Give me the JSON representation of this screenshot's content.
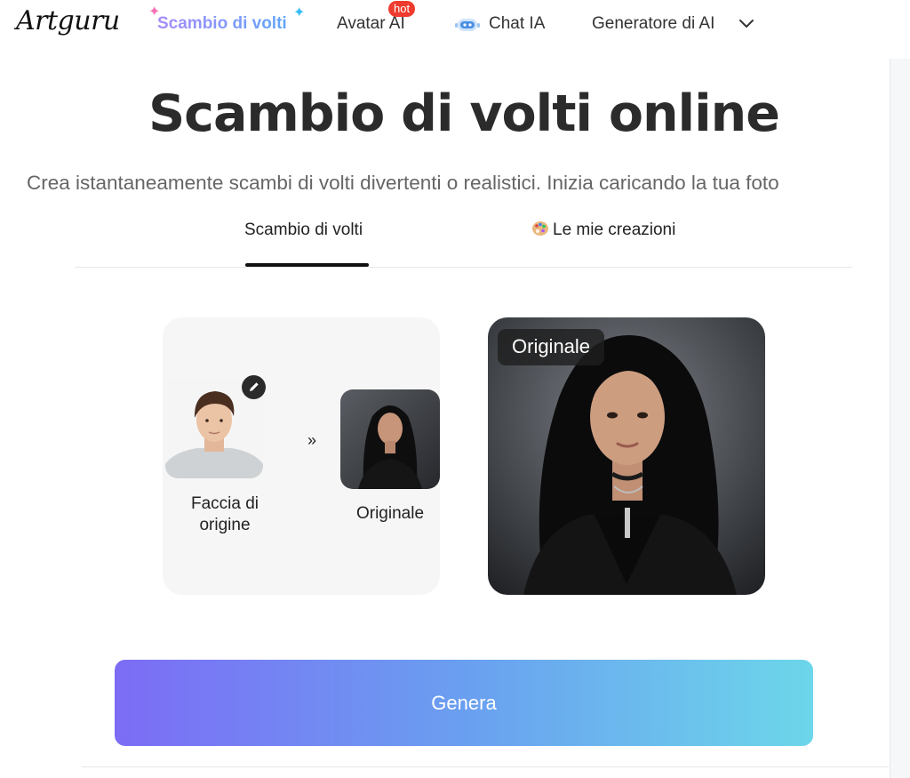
{
  "nav": {
    "logo": "Artguru",
    "items": [
      {
        "label": "Scambio di volti"
      },
      {
        "label": "Avatar AI",
        "badge": "hot"
      },
      {
        "label": "Chat IA"
      },
      {
        "label": "Generatore di AI"
      }
    ]
  },
  "hero": {
    "title": "Scambio di volti online",
    "subtitle": "Crea istantaneamente scambi di volti divertenti o realistici. Inizia caricando la tua foto"
  },
  "tabs": [
    {
      "label": "Scambio di volti",
      "active": true
    },
    {
      "label": "Le mie creazioni",
      "active": false
    }
  ],
  "swap": {
    "source_label": "Faccia di origine",
    "arrow": "»",
    "target_label": "Originale"
  },
  "preview": {
    "badge": "Originale"
  },
  "actions": {
    "generate": "Genera"
  },
  "colors": {
    "hot_badge": "#ef3b2d",
    "gradient_start": "#7c6cf5",
    "gradient_end": "#6cd6ea"
  }
}
